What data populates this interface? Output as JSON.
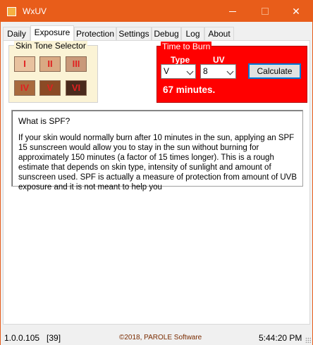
{
  "window": {
    "title": "WxUV",
    "accent": "#e85d1a"
  },
  "tabs": [
    {
      "label": "Daily",
      "active": false
    },
    {
      "label": "Exposure",
      "active": true
    },
    {
      "label": "Protection",
      "active": false
    },
    {
      "label": "Settings",
      "active": false
    },
    {
      "label": "Debug",
      "active": false
    },
    {
      "label": "Log",
      "active": false
    },
    {
      "label": "About",
      "active": false
    }
  ],
  "skin_selector": {
    "legend": "Skin Tone Selector",
    "buttons": [
      {
        "label": "I",
        "color": "#e8c29f"
      },
      {
        "label": "II",
        "color": "#d9a983"
      },
      {
        "label": "III",
        "color": "#c9997a"
      },
      {
        "label": "IV",
        "color": "#a86a3e"
      },
      {
        "label": "V",
        "color": "#8b4a25"
      },
      {
        "label": "VI",
        "color": "#4a2a1c"
      }
    ]
  },
  "time_to_burn": {
    "legend": "Time to Burn",
    "type_label": "Type",
    "uv_label": "UV",
    "type_value": "V",
    "uv_value": "8",
    "calculate_label": "Calculate",
    "result": "67 minutes.",
    "background": "#ff0000"
  },
  "spf_info": {
    "title": "What is SPF?",
    "body": "If your skin would normally burn after 10 minutes in the sun, applying an SPF 15 sunscreen would allow you to stay in the sun without burning for approximately 150 minutes (a factor of 15 times longer).  This is a rough estimate that depends on skin type, intensity of sunlight and amount of sunscreen used. SPF is actually a measure of protection from amount of UVB exposure and it is not meant to help you"
  },
  "statusbar": {
    "version": "1.0.0.105   [39]",
    "copyright": "©2018, PAROLE Software",
    "time": "5:44:20 PM"
  }
}
